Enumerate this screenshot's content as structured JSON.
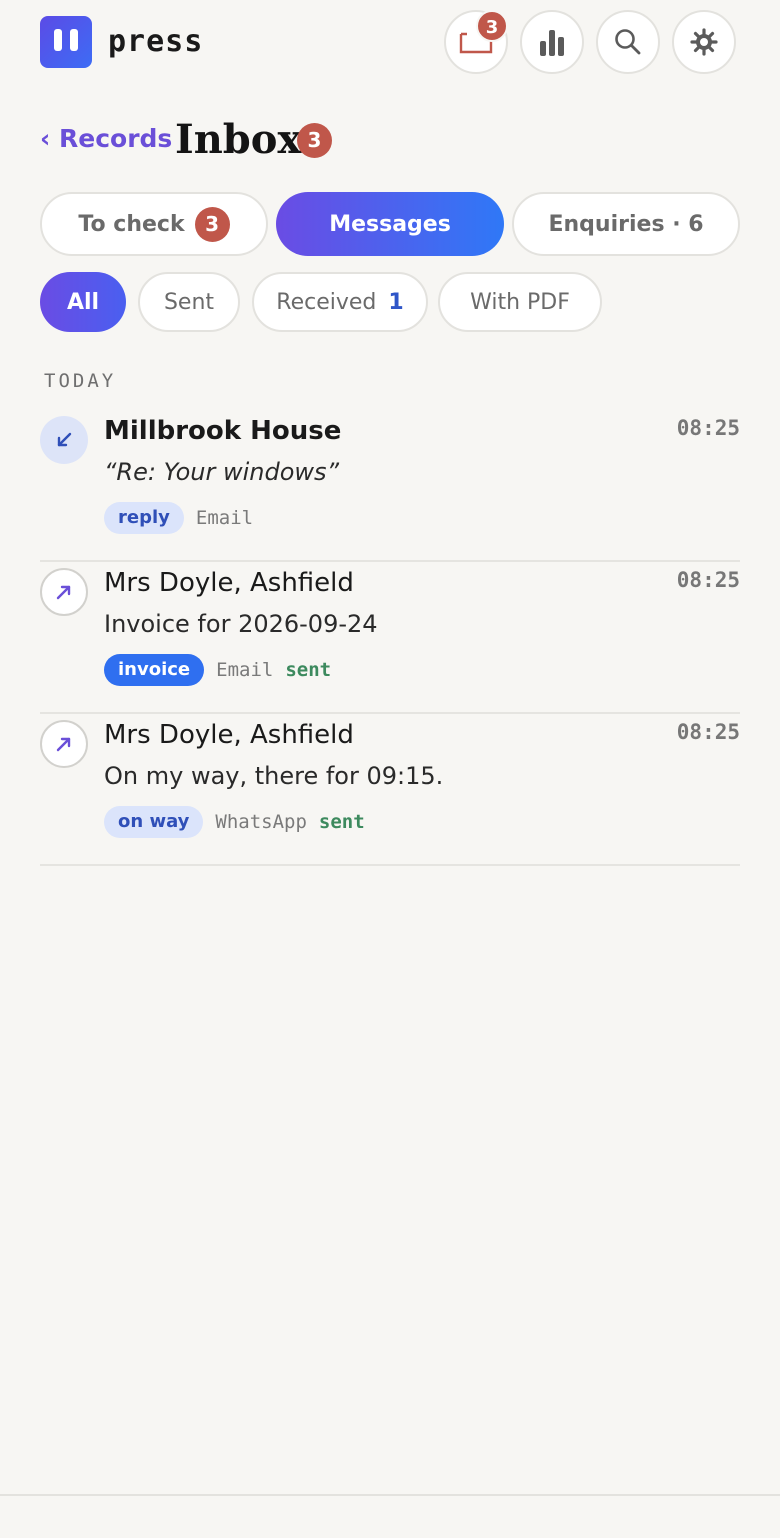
{
  "app": {
    "brand": "press"
  },
  "header": {
    "buttons": [
      {
        "icon": "inbox-tray-icon",
        "badge": "3"
      },
      {
        "icon": "bar-chart-icon"
      },
      {
        "icon": "search-icon"
      },
      {
        "icon": "gear-icon"
      }
    ]
  },
  "nav": {
    "back_label": "‹ Records",
    "title": "Inbox",
    "title_badge": "3"
  },
  "tabs": [
    {
      "label": "To check",
      "badge": "3"
    },
    {
      "label": "Messages",
      "active": true
    },
    {
      "label": "Enquiries · 6"
    }
  ],
  "filters": [
    {
      "label": "All",
      "active": true
    },
    {
      "label": "Sent"
    },
    {
      "label": "Received",
      "count": "1"
    },
    {
      "label": "With PDF"
    }
  ],
  "section_label": "TODAY",
  "messages": [
    {
      "direction": "incoming",
      "name": "Millbrook House",
      "time": "08:25",
      "preview": "“Re: Your windows”",
      "tag": "reply",
      "tag_style": "soft",
      "channel": "Email",
      "status": ""
    },
    {
      "direction": "outgoing",
      "name": "Mrs Doyle, Ashfield",
      "time": "08:25",
      "preview": "Invoice for 2026-09-24",
      "tag": "invoice",
      "tag_style": "solid",
      "channel": "Email",
      "status": "sent"
    },
    {
      "direction": "outgoing",
      "name": "Mrs Doyle, Ashfield",
      "time": "08:25",
      "preview": "On my way, there for 09:15.",
      "tag": "on way",
      "tag_style": "soft",
      "channel": "WhatsApp",
      "status": "sent"
    }
  ],
  "colors": {
    "accent": "#6a4ce4",
    "accent_end": "#2f78f7",
    "badge": "#c0574a",
    "sent": "#3d8a5e"
  }
}
